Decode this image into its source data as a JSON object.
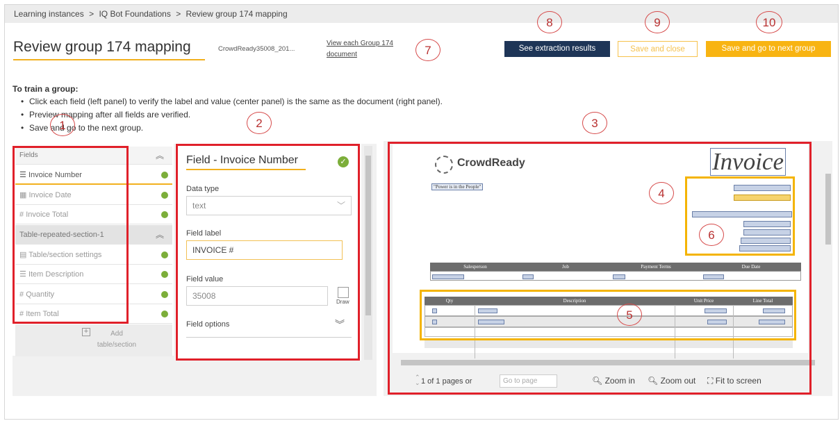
{
  "breadcrumb": [
    "Learning instances",
    ">",
    "IQ Bot Foundations",
    ">",
    "Review group 174 mapping"
  ],
  "header": {
    "title": "Review group 174 mapping",
    "document_name": "CrowdReady35008_201...",
    "view_link": "View each Group 174 document"
  },
  "buttons": {
    "see_results": "See extraction results",
    "save_close": "Save and close",
    "save_next": "Save and go to next group"
  },
  "instructions": {
    "heading": "To train a group:",
    "steps": [
      "Click each field (left panel) to verify the label and value (center panel) is the same as the document (right panel).",
      "Preview mapping after all fields are verified.",
      "Save and go to the next group."
    ]
  },
  "fields_panel": {
    "header": "Fields",
    "items": [
      "Invoice Number",
      "Invoice Date",
      "Invoice Total"
    ],
    "section_header": "Table-repeated-section-1",
    "section_items": [
      "Table/section settings",
      "Item Description",
      "Quantity",
      "Item Total"
    ],
    "add_label": "Add table/section"
  },
  "field_detail": {
    "title": "Field - Invoice Number",
    "data_type_label": "Data type",
    "data_type_value": "text",
    "field_label_label": "Field label",
    "field_label_value": "INVOICE #",
    "field_value_label": "Field value",
    "field_value_value": "35008",
    "draw_label": "Draw",
    "options_label": "Field options"
  },
  "document": {
    "logo": "CrowdReady",
    "invoice_title": "Invoice",
    "slogan": "\"Power is in the People\"",
    "table1_headers": [
      "Salesperson",
      "Job",
      "Payment Terms",
      "Due Date"
    ],
    "table2_headers": [
      "Qty",
      "Description",
      "Unit Price",
      "Line Total"
    ]
  },
  "doc_controls": {
    "pages": "1 of 1 pages or",
    "go_placeholder": "Go to page",
    "zoom_in": "Zoom in",
    "zoom_out": "Zoom out",
    "fit": "Fit to screen"
  },
  "callouts": [
    "1",
    "2",
    "3",
    "4",
    "5",
    "6",
    "7",
    "8",
    "9",
    "10"
  ],
  "colors": {
    "accent": "#f8b412",
    "dark_button": "#1e3557",
    "callout_red": "#e0202a",
    "check_green": "#7cae3a"
  }
}
